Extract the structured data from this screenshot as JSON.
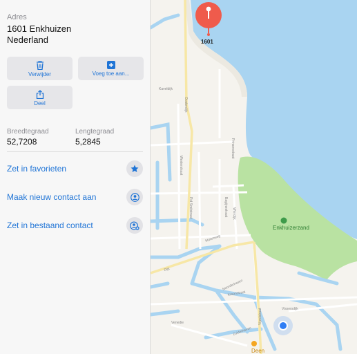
{
  "address": {
    "label": "Adres",
    "line1": "1601 Enkhuizen",
    "line2": "Nederland"
  },
  "buttons": {
    "delete": "Verwijder",
    "add": "Voeg toe aan...",
    "share": "Deel"
  },
  "coordinates": {
    "lat_label": "Breedtegraad",
    "lat_value": "52,7208",
    "lon_label": "Lengtegraad",
    "lon_value": "5,2845"
  },
  "actions": {
    "favorite": "Zet in favorieten",
    "new_contact": "Maak nieuw contact aan",
    "existing_contact": "Zet in bestaand contact"
  },
  "map": {
    "pin_label": "1601",
    "park_label": "Enkhuizerzand",
    "poi_label": "Deen",
    "street_labels": [
      "Kaveldijk",
      "Oosterdijk",
      "Pid Smitstraat",
      "Westerstraat",
      "Vijzelstraat",
      "Noorderhaven",
      "Vissersdijk",
      "Venedie",
      "Zuiderhaven",
      "Dijk",
      "Molenweg",
      "Bagijnestraat",
      "Prinsenstraat",
      "Wierdijk",
      "Kraanstraat"
    ],
    "colors": {
      "water": "#a9d4f1",
      "land": "#f5f3ee",
      "park": "#b9e2a2",
      "road_major": "#f7e7a6",
      "pin": "#ef5b4c",
      "location_dot": "#2f7ef5"
    }
  }
}
